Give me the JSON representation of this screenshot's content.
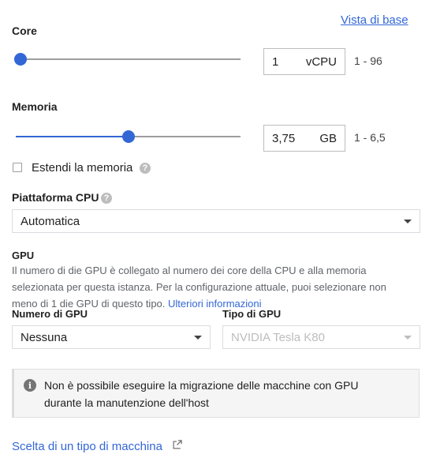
{
  "header": {
    "basic_view_link": "Vista di base"
  },
  "cores": {
    "label": "Core",
    "slider_value_fraction": 0.0,
    "value": "1",
    "unit": "vCPU",
    "range": "1 - 96"
  },
  "memory": {
    "label": "Memoria",
    "slider_value_fraction": 0.5,
    "value": "3,75",
    "unit": "GB",
    "range": "1 - 6,5",
    "extend_label": "Estendi la memoria",
    "extend_checked": false
  },
  "cpu_platform": {
    "label": "Piattaforma CPU",
    "selected": "Automatica"
  },
  "gpu": {
    "title": "GPU",
    "description": "Il numero di die GPU è collegato al numero dei core della CPU e alla memoria selezionata per questa istanza. Per la configurazione attuale, puoi selezionare non meno di 1 die GPU di questo tipo.",
    "more_info_link": "Ulteriori informazioni",
    "count_label": "Numero di GPU",
    "count_selected": "Nessuna",
    "type_label": "Tipo di GPU",
    "type_selected": "NVIDIA Tesla K80"
  },
  "notice": {
    "line1": "Non è possibile eseguire la migrazione delle macchine con GPU",
    "line2": "durante la manutenzione dell'host"
  },
  "footer": {
    "machine_type_link": "Scelta di un tipo di macchina"
  },
  "colors": {
    "accent": "#3367d6",
    "track": "#9e9e9e",
    "disabled": "#bdbdbd"
  },
  "icons": {
    "help": "help-circle-icon",
    "info": "info-circle-icon",
    "external": "open-in-new-icon"
  }
}
